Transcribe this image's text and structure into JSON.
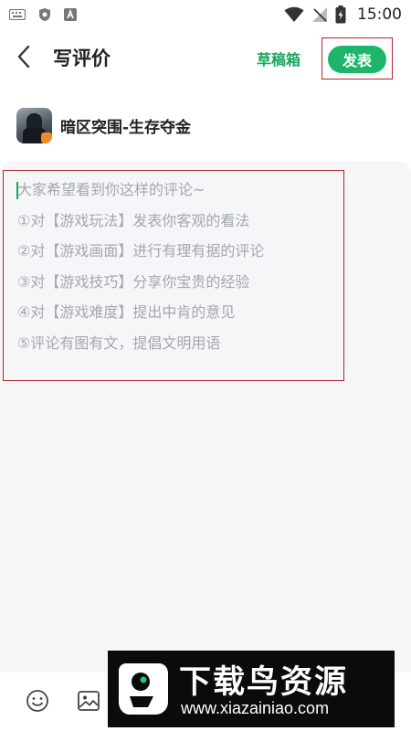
{
  "status_bar": {
    "time": "15:00",
    "left_icons": [
      "keyboard-icon",
      "shield-icon",
      "a-box-icon"
    ],
    "right_icons": [
      "wifi-icon",
      "no-signal-icon",
      "battery-charging-icon"
    ]
  },
  "header": {
    "back_icon": "chevron-left-icon",
    "title": "写评价",
    "drafts_label": "草稿箱",
    "publish_label": "发表"
  },
  "game": {
    "name": "暗区突围-生存夺金"
  },
  "editor": {
    "hints": [
      "大家希望看到你这样的评论~",
      "①对【游戏玩法】发表你客观的看法",
      "②对【游戏画面】进行有理有据的评论",
      "③对【游戏技巧】分享你宝贵的经验",
      "④对【游戏难度】提出中肯的意见",
      "⑤评论有图有文，提倡文明用语"
    ]
  },
  "toolbar": {
    "icons": [
      "emoji-icon",
      "image-icon"
    ]
  },
  "watermark": {
    "title": "下载鸟资源",
    "url": "www.xiazainiao.com"
  },
  "colors": {
    "accent": "#1db56a",
    "highlight_border": "#b3262c",
    "hint_text": "#a3a8b0",
    "editor_bg": "#f5f6f8"
  }
}
